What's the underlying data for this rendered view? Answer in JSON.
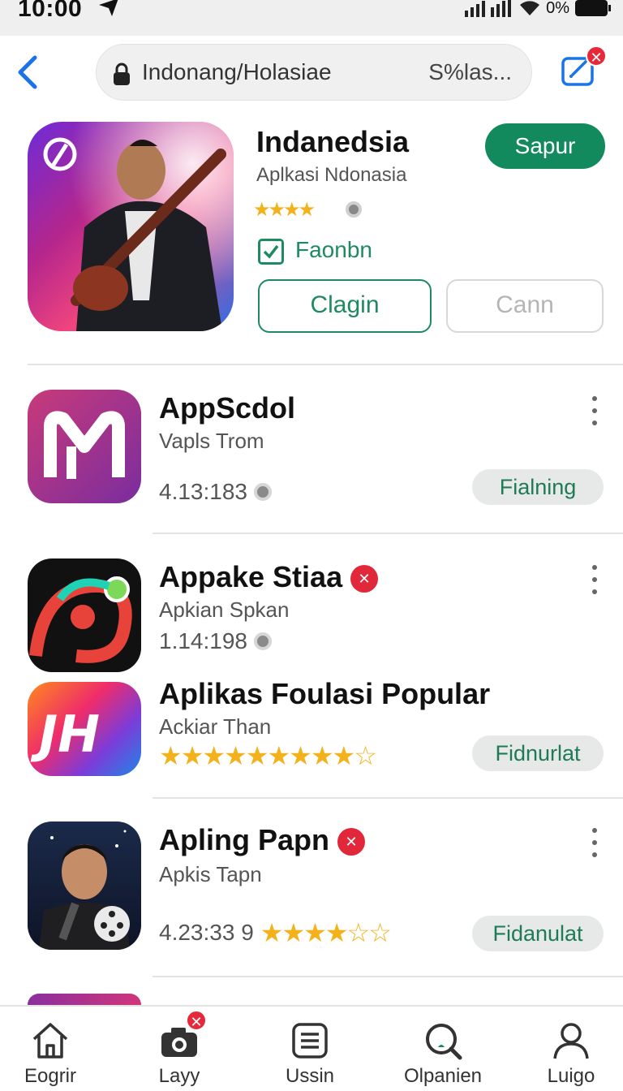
{
  "status": {
    "time": "10:00",
    "battery": "0%"
  },
  "search": {
    "query": "Indonang/Holasiae",
    "hint": "S%las..."
  },
  "header": {
    "edit_badge": "✕"
  },
  "featured": {
    "title": "Indanedsia",
    "subtitle": "Aplkasi Ndonasia",
    "stars": "★★★★",
    "check_label": "Faonbn",
    "primary_button": "Sapur",
    "outline_button": "Clagin",
    "disabled_button": "Cann"
  },
  "apps": [
    {
      "name": "AppScdol",
      "developer": "Vapls Trom",
      "meta": "4.13:183",
      "action": "Fialning"
    },
    {
      "name": "Appake Stiaa",
      "developer": "Apkian Spkan",
      "meta": "1.14:198",
      "badge": "✕"
    },
    {
      "name": "Aplikas Foulasi Popular",
      "developer": "Ackiar Than",
      "stars": "★★★★★★★★★",
      "stars_empty": "☆",
      "action": "Fidnurlat"
    },
    {
      "name": "Apling Papn",
      "developer": "Apkis Tapn",
      "meta": "4.23:33 9",
      "stars": "★★★★",
      "stars_empty": "☆☆",
      "badge": "✕",
      "action": "Fidanulat"
    }
  ],
  "bottom_nav": [
    {
      "label": "Eogrir",
      "icon": "home-icon"
    },
    {
      "label": "Layy",
      "icon": "camera-icon",
      "badge": "✕"
    },
    {
      "label": "Ussin",
      "icon": "list-icon"
    },
    {
      "label": "Olpanien",
      "icon": "search-icon"
    },
    {
      "label": "Luigo",
      "icon": "profile-icon"
    }
  ],
  "colors": {
    "accent": "#128a5e",
    "badge": "#e0283a",
    "star": "#f3b21c"
  }
}
